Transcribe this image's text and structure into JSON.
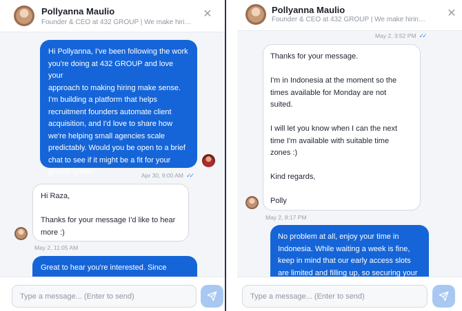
{
  "contact": {
    "name": "Pollyanna Maulio",
    "subtitle": "Founder & CEO at 432 GROUP | We make hiring m..."
  },
  "left": {
    "messages": [
      {
        "direction": "outgoing",
        "text": "Hi Pollyanna, I've been following the work\nyou're doing at 432 GROUP and love your\napproach to making hiring make sense.\nI'm building a platform that helps\nrecruitment founders automate client\nacquisition, and I'd love to share how\nwe're helping small agencies scale\npredictably. Would you be open to a brief\nchat to see if it might be a fit for your\ngrowth goals?",
        "time": "Apr 30, 9:00 AM"
      },
      {
        "direction": "incoming",
        "text": "Hi Raza,\n\nThanks for your message I'd like to hear\nmore :)",
        "time": "May 2, 11:05 AM"
      },
      {
        "direction": "outgoing",
        "text": "Great to hear you're interested. Since\nwe're looking to work on a client..."
      }
    ]
  },
  "right": {
    "top_time": "May 2, 3:52 PM",
    "messages": [
      {
        "direction": "incoming",
        "text": "Thanks for your message.\n\nI'm in Indonesia at the moment so the\ntimes available for Monday are not\nsuited.\n\nI will let you know when I can the next\ntime I'm available with suitable time\nzones :)\n\nKind regards,\n\nPolly",
        "time": "May 2, 8:17 PM"
      },
      {
        "direction": "outgoing",
        "text": "No problem at all, enjoy your time in\nIndonesia. While waiting a week is fine,\nkeep in mind that our early access slots\nare limited and filling up, so securing your\nspot sooner..."
      }
    ]
  },
  "composer": {
    "placeholder": "Type a message... (Enter to send)"
  },
  "colors": {
    "outgoing_bubble": "#1565d8",
    "incoming_bubble": "#ffffff",
    "send_button": "#a8c8f2",
    "read_ticks": "#4d8ae6"
  },
  "icons": [
    "close-icon",
    "send-icon",
    "read-receipt-icon"
  ]
}
